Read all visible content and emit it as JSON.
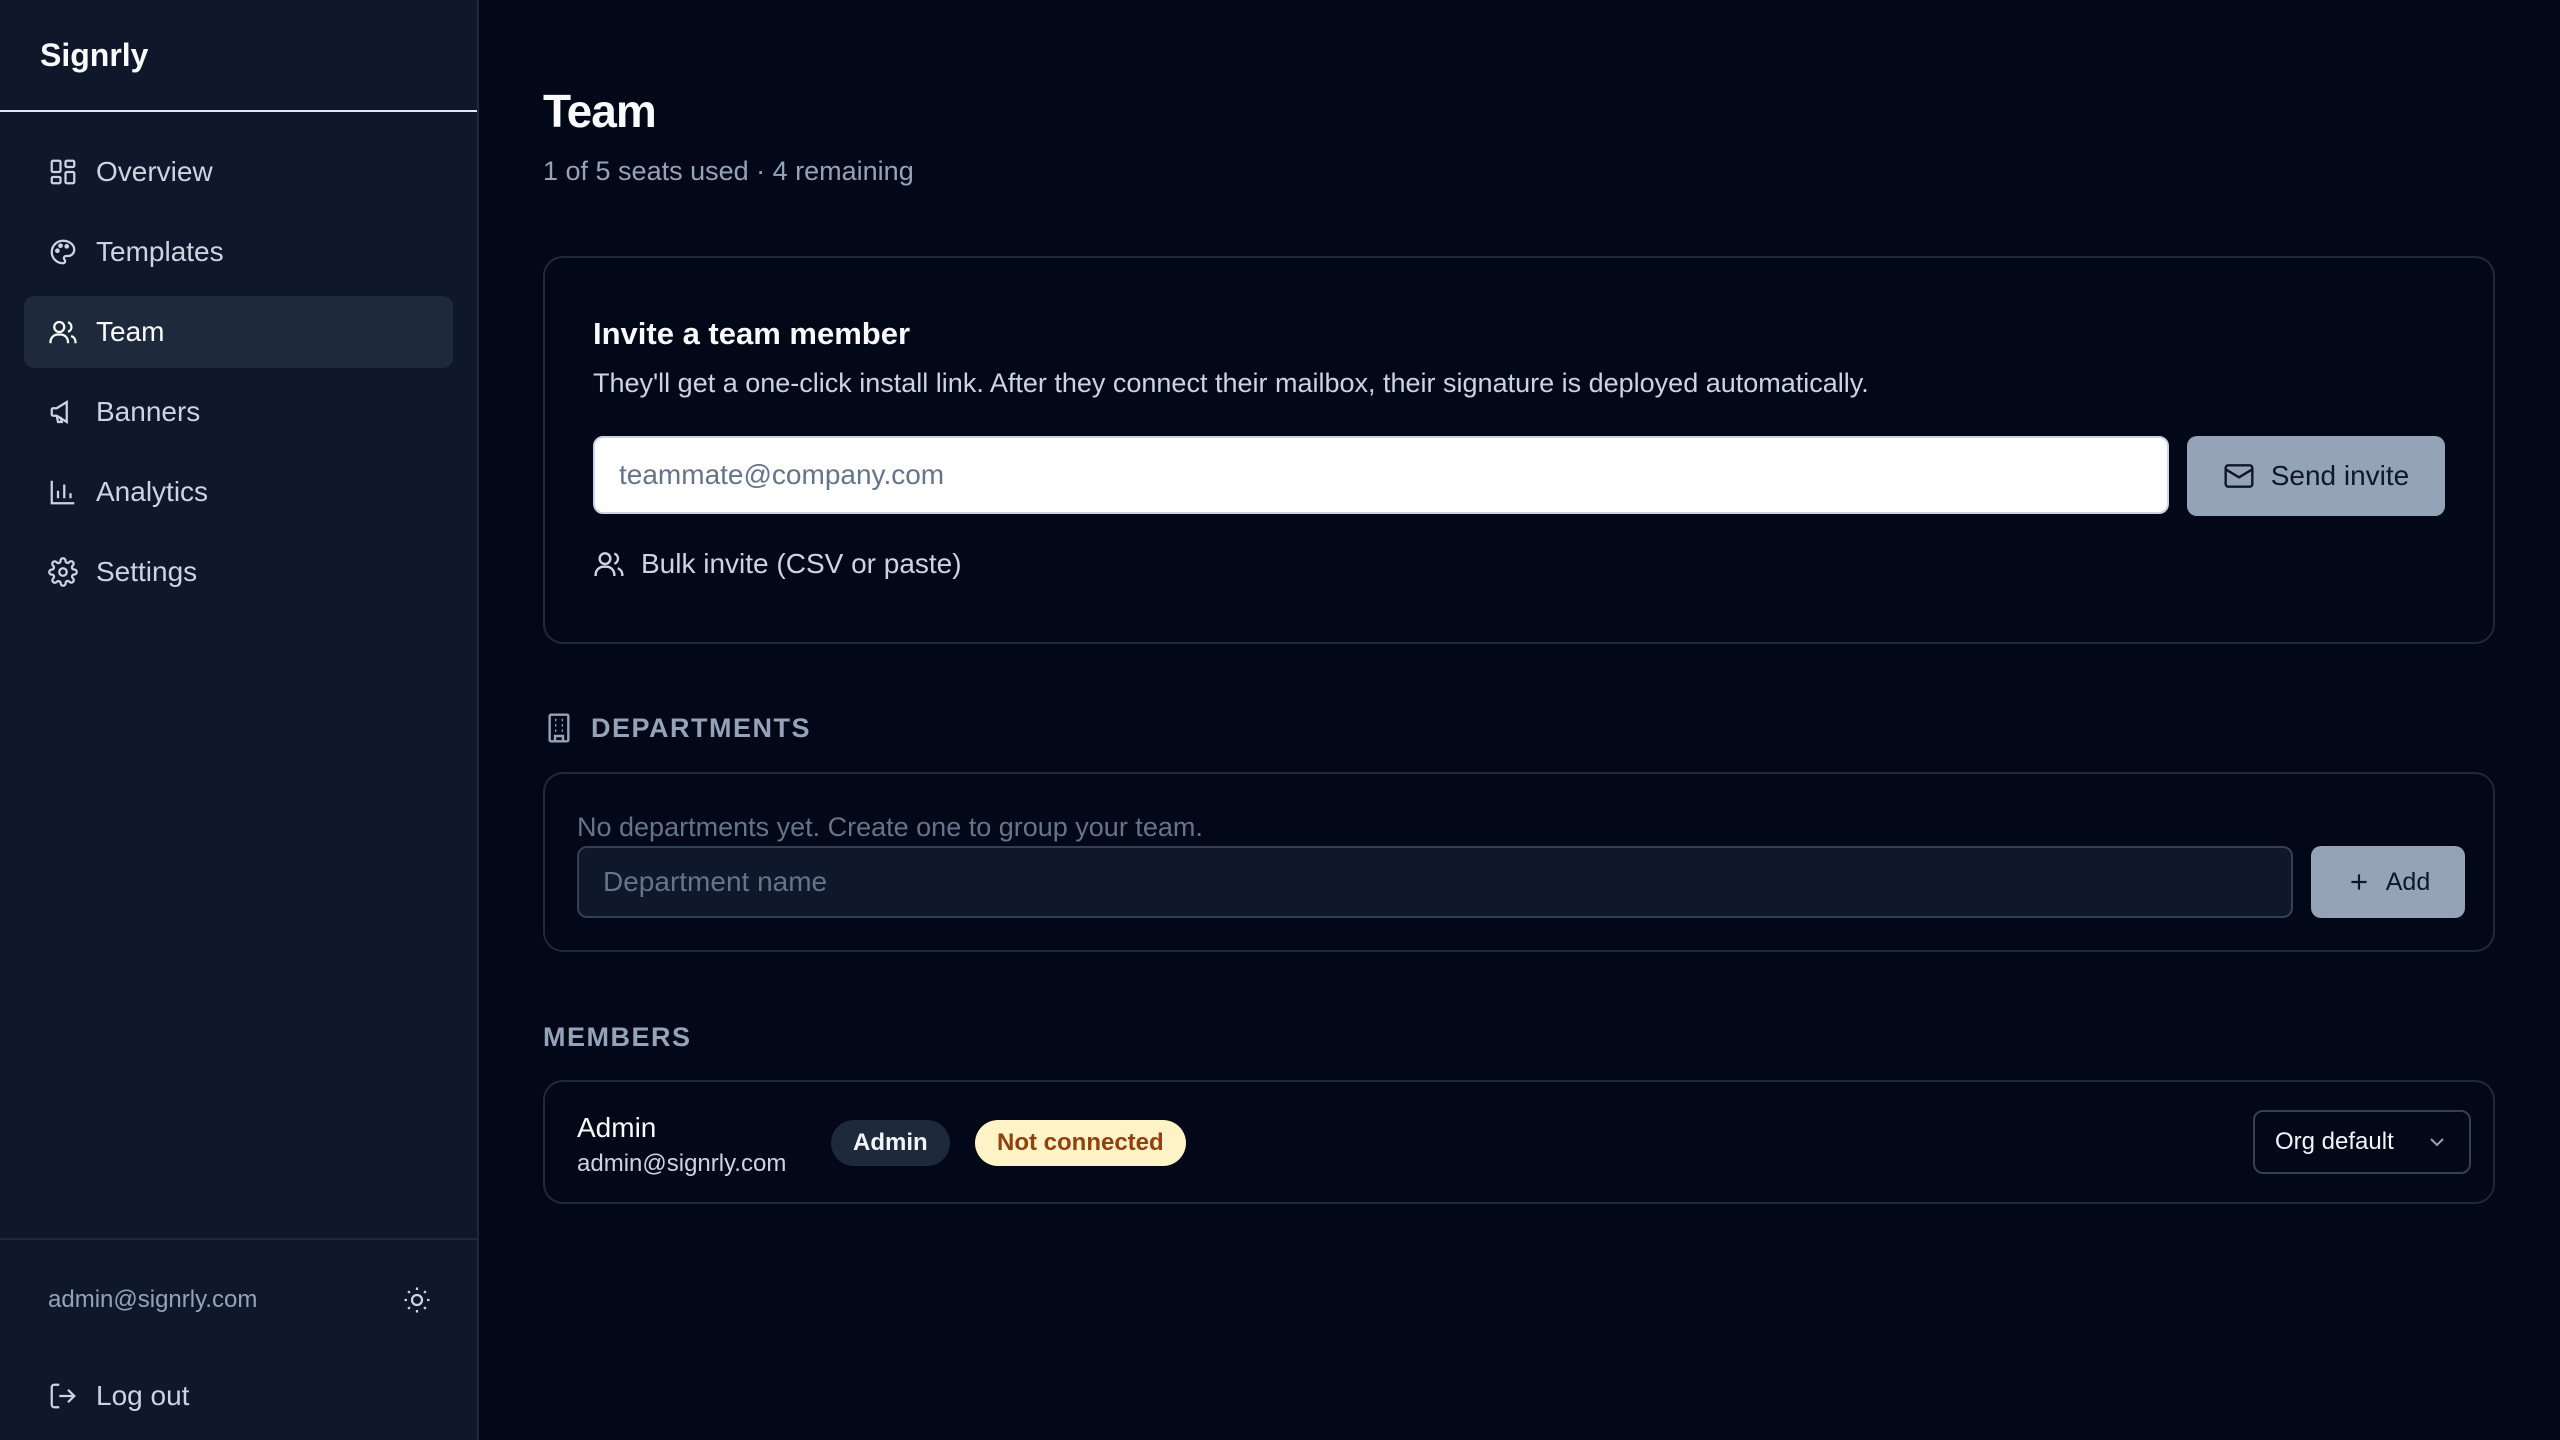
{
  "app": {
    "name": "Signrly"
  },
  "sidebar": {
    "items": [
      {
        "label": "Overview",
        "icon": "grid-icon"
      },
      {
        "label": "Templates",
        "icon": "palette-icon"
      },
      {
        "label": "Team",
        "icon": "users-icon",
        "active": true
      },
      {
        "label": "Banners",
        "icon": "megaphone-icon"
      },
      {
        "label": "Analytics",
        "icon": "bar-chart-icon"
      },
      {
        "label": "Settings",
        "icon": "gear-icon"
      }
    ],
    "user_email": "admin@signrly.com",
    "logout_label": "Log out"
  },
  "header": {
    "title": "Team",
    "subtitle": "1 of 5 seats used · 4 remaining"
  },
  "invite": {
    "title": "Invite a team member",
    "description": "They'll get a one-click install link. After they connect their mailbox, their signature is deployed automatically.",
    "email_placeholder": "teammate@company.com",
    "send_label": "Send invite",
    "bulk_label": "Bulk invite (CSV or paste)"
  },
  "departments": {
    "heading": "DEPARTMENTS",
    "empty_text": "No departments yet. Create one to group your team.",
    "input_placeholder": "Department name",
    "add_label": "Add"
  },
  "members": {
    "heading": "MEMBERS",
    "rows": [
      {
        "name": "Admin",
        "email": "admin@signrly.com",
        "role": "Admin",
        "status": "Not connected",
        "template": "Org default"
      }
    ]
  },
  "colors": {
    "background": "#020817",
    "sidebar": "#0f172a",
    "accent_button": "#94a3b8",
    "status_badge_bg": "#fef3c7",
    "status_badge_text": "#92400e"
  }
}
